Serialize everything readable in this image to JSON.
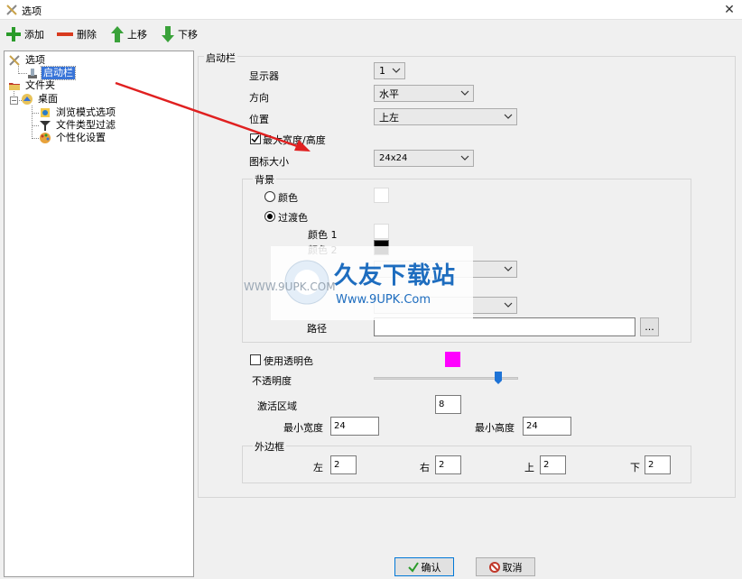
{
  "window": {
    "title": "选项",
    "close_glyph": "✕"
  },
  "toolbar": {
    "add": "添加",
    "delete": "删除",
    "move_up": "上移",
    "move_down": "下移"
  },
  "tree": {
    "root": "选项",
    "launcher": "启动栏",
    "folder": "文件夹",
    "desktop": "桌面",
    "browse_mode": "浏览模式选项",
    "filetype_filter": "文件类型过滤",
    "personalize": "个性化设置"
  },
  "launcher": {
    "group_title": "启动栏",
    "display_label": "显示器",
    "display_value": "1",
    "direction_label": "方向",
    "direction_value": "水平",
    "position_label": "位置",
    "position_value": "上左",
    "max_wh_label": "最大宽度/高度",
    "max_wh_checked": true,
    "icon_size_label": "图标大小",
    "icon_size_value": "24x24"
  },
  "background": {
    "group_title": "背景",
    "color_label": "颜色",
    "gradient_label": "过渡色",
    "color1_label": "颜色 1",
    "color2_label": "颜色 2",
    "path_label": "路径",
    "browse_label": "...",
    "swatch_color": "#ffffff",
    "color1": "#ffffff",
    "color2": "#000000"
  },
  "transparency": {
    "use_transparent_label": "使用透明色",
    "transparent_color": "#ff00ff",
    "opacity_label": "不透明度",
    "opacity_fraction": 0.86
  },
  "activation": {
    "label": "激活区域",
    "value": "8",
    "min_width_label": "最小宽度",
    "min_width_value": "24",
    "min_height_label": "最小高度",
    "min_height_value": "24"
  },
  "margins": {
    "group_title": "外边框",
    "left_label": "左",
    "left_value": "2",
    "right_label": "右",
    "right_value": "2",
    "top_label": "上",
    "top_value": "2",
    "bottom_label": "下",
    "bottom_value": "2"
  },
  "watermark": {
    "brand": "久友下载站",
    "url_right": "Www.9UPK.Com",
    "url_left": "WWW.9UPK.COM"
  },
  "footer": {
    "ok": "确认",
    "cancel": "取消"
  },
  "colors": {
    "accent": "#3874d8",
    "arrow": "#e02020",
    "add_green": "#2a9b2a",
    "delete_red": "#d83a1e"
  }
}
